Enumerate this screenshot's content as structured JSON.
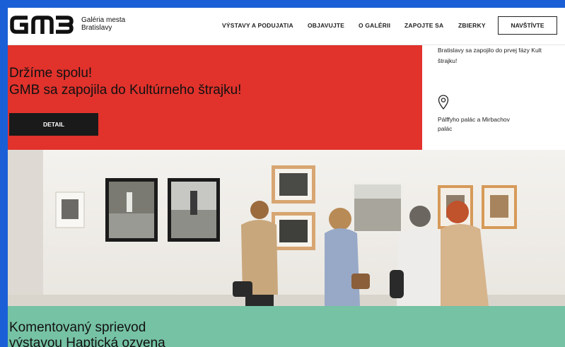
{
  "header": {
    "logo_text": "GMB",
    "org_name_line1": "Galéria mesta",
    "org_name_line2": "Bratislavy",
    "nav": [
      {
        "label": "VÝSTAVY A PODUJATIA"
      },
      {
        "label": "OBJAVUJTE"
      },
      {
        "label": "O GALÉRII"
      },
      {
        "label": "ZAPOJTE SA"
      },
      {
        "label": "ZBIERKY"
      }
    ],
    "visit_label": "NAVŠTÍVTE"
  },
  "hero": {
    "title": "Držíme spolu!",
    "subtitle": "GMB sa zapojila do Kultúrneho štrajku!",
    "detail_label": "DETAIL",
    "side_text_line1": "Bratislavy sa zapojilo do prvej fázy Kult",
    "side_text_line2": "štrajku!",
    "location_line1": "Pálffyho palác a Mirbachov",
    "location_line2": "palác",
    "icon": "map-pin-icon"
  },
  "feature": {
    "title_line1": "Komentovaný sprievod",
    "title_line2": "výstavou Haptická ozvena"
  },
  "colors": {
    "frame": "#1a5fd6",
    "hero_red": "#e1322c",
    "teal": "#76c2a4",
    "button_dark": "#1a1a1a"
  }
}
